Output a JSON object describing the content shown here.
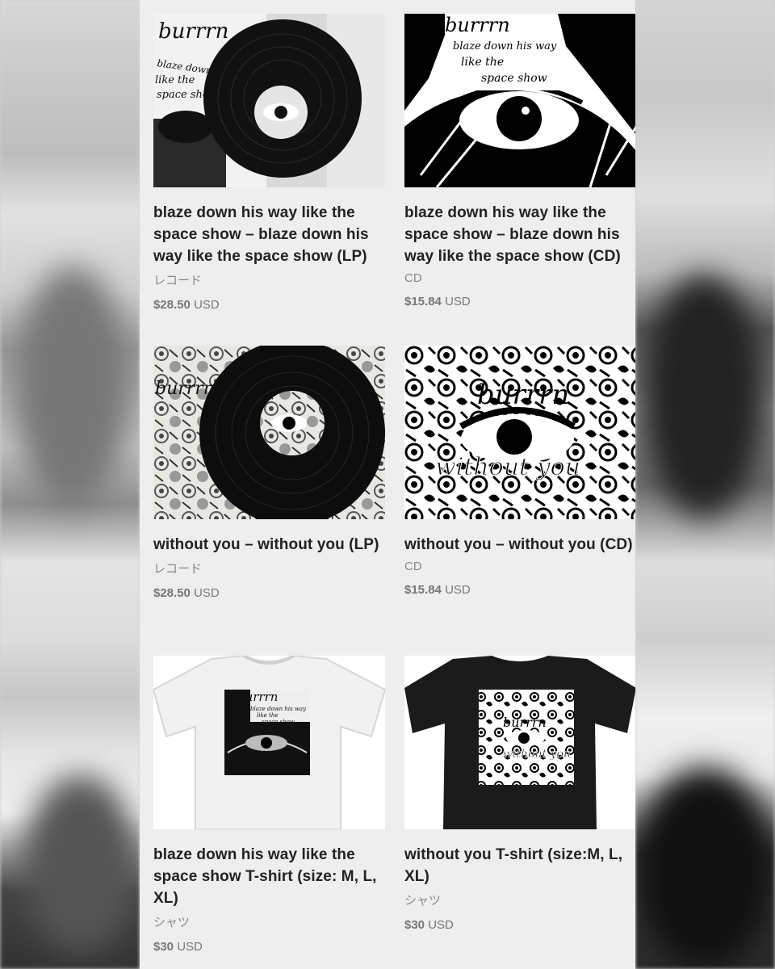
{
  "products": [
    {
      "title": "blaze down his way like the space show – blaze down his way like the space show (LP)",
      "category": "レコード",
      "price": "$28.50",
      "currency": "USD",
      "art_text": [
        "burrrn",
        "blaze down his way",
        "like the",
        "space show"
      ]
    },
    {
      "title": "blaze down his way like the space show – blaze down his way like the space show (CD)",
      "category": "CD",
      "price": "$15.84",
      "currency": "USD",
      "art_text": [
        "burrrn",
        "blaze down his way",
        "like the",
        "space show"
      ]
    },
    {
      "title": "without you – without you (LP)",
      "category": "レコード",
      "price": "$28.50",
      "currency": "USD",
      "art_text": [
        "burrrn"
      ]
    },
    {
      "title": "without you – without you (CD)",
      "category": "CD",
      "price": "$15.84",
      "currency": "USD",
      "art_text": [
        "burrrn",
        "without you"
      ]
    },
    {
      "title": "blaze down his way like the space show T-shirt (size: M, L, XL)",
      "category": "シャツ",
      "price": "$30",
      "currency": "USD",
      "art_text": [
        "burrrn",
        "blaze down his way",
        "like the",
        "space show"
      ]
    },
    {
      "title": "without you T-shirt (size:M, L, XL)",
      "category": "シャツ",
      "price": "$30",
      "currency": "USD",
      "art_text": [
        "burrrn",
        "without you"
      ]
    }
  ]
}
